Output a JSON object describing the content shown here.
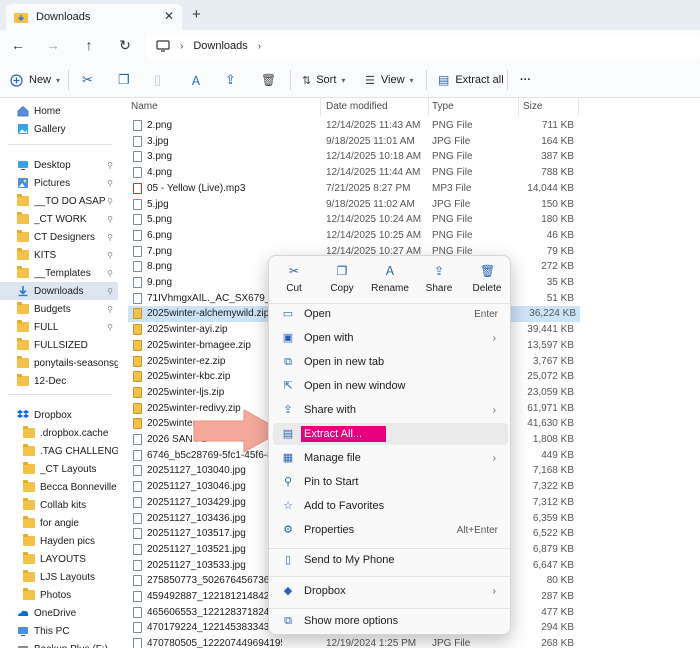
{
  "window": {
    "tab_title": "Downloads",
    "close_glyph": "✕",
    "newtab_glyph": "+"
  },
  "address": {
    "crumbs": [
      "Downloads"
    ],
    "crumb_sep": "›"
  },
  "toolbar": {
    "new_label": "New",
    "sort_label": "Sort",
    "view_label": "View",
    "extract_label": "Extract all",
    "more_glyph": "···"
  },
  "sidebar": {
    "items": [
      {
        "label": "Home",
        "icon": "home-icon"
      },
      {
        "label": "Gallery",
        "icon": "gallery-icon"
      },
      {
        "label": "Desktop",
        "icon": "desktop-icon",
        "pinned": true
      },
      {
        "label": "Pictures",
        "icon": "pictures-icon",
        "pinned": true
      },
      {
        "label": "__TO DO ASAP",
        "icon": "folder-icon",
        "pinned": true
      },
      {
        "label": "_CT WORK",
        "icon": "folder-icon",
        "pinned": true
      },
      {
        "label": "CT Designers",
        "icon": "folder-icon",
        "pinned": true
      },
      {
        "label": "KITS",
        "icon": "folder-icon",
        "pinned": true
      },
      {
        "label": "__Templates",
        "icon": "folder-icon",
        "pinned": true
      },
      {
        "label": "Downloads",
        "icon": "download-icon",
        "pinned": true
      },
      {
        "label": "Budgets",
        "icon": "folder-icon",
        "pinned": true
      },
      {
        "label": "FULL",
        "icon": "folder-icon",
        "pinned": true
      },
      {
        "label": "FULLSIZED",
        "icon": "folder-icon"
      },
      {
        "label": "ponytails-seasonsgre",
        "icon": "folder-icon"
      },
      {
        "label": "12-Dec",
        "icon": "folder-icon"
      },
      {
        "label": "Dropbox",
        "icon": "dropbox-icon"
      },
      {
        "label": ".dropbox.cache",
        "icon": "folder-icon"
      },
      {
        "label": ".TAG CHALLENGE 2",
        "icon": "folder-icon"
      },
      {
        "label": "_CT Layouts",
        "icon": "folder-icon"
      },
      {
        "label": "Becca Bonneville C1",
        "icon": "folder-icon"
      },
      {
        "label": "Collab kits",
        "icon": "folder-icon"
      },
      {
        "label": "for angie",
        "icon": "folder-icon"
      },
      {
        "label": "Hayden pics",
        "icon": "folder-icon"
      },
      {
        "label": "LAYOUTS",
        "icon": "folder-icon"
      },
      {
        "label": "LJS Layouts",
        "icon": "folder-icon"
      },
      {
        "label": "Photos",
        "icon": "folder-icon"
      },
      {
        "label": "OneDrive",
        "icon": "onedrive-icon"
      },
      {
        "label": "This PC",
        "icon": "pc-icon"
      },
      {
        "label": "Backup Plus (F:)",
        "icon": "drive-icon"
      }
    ],
    "pin_glyph": "📌"
  },
  "columns": {
    "name": "Name",
    "date": "Date modified",
    "type": "Type",
    "size": "Size"
  },
  "files": [
    {
      "name": "2.png",
      "date": "12/14/2025 11:43 AM",
      "type": "PNG File",
      "size": "711 KB",
      "kind": "img"
    },
    {
      "name": "3.jpg",
      "date": "9/18/2025 11:01 AM",
      "type": "JPG File",
      "size": "164 KB",
      "kind": "img"
    },
    {
      "name": "3.png",
      "date": "12/14/2025 10:18 AM",
      "type": "PNG File",
      "size": "387 KB",
      "kind": "img"
    },
    {
      "name": "4.png",
      "date": "12/14/2025 11:44 AM",
      "type": "PNG File",
      "size": "788 KB",
      "kind": "img"
    },
    {
      "name": "05 - Yellow (Live).mp3",
      "date": "7/21/2025 8:27 PM",
      "type": "MP3 File",
      "size": "14,044 KB",
      "kind": "mp3"
    },
    {
      "name": "5.jpg",
      "date": "9/18/2025 11:02 AM",
      "type": "JPG File",
      "size": "150 KB",
      "kind": "img"
    },
    {
      "name": "5.png",
      "date": "12/14/2025 10:24 AM",
      "type": "PNG File",
      "size": "180 KB",
      "kind": "img"
    },
    {
      "name": "6.png",
      "date": "12/14/2025 10:25 AM",
      "type": "PNG File",
      "size": "46 KB",
      "kind": "img"
    },
    {
      "name": "7.png",
      "date": "12/14/2025 10:27 AM",
      "type": "PNG File",
      "size": "79 KB",
      "kind": "img"
    },
    {
      "name": "8.png",
      "date": "",
      "type": "",
      "size": "272 KB",
      "kind": "img"
    },
    {
      "name": "9.png",
      "date": "",
      "type": "",
      "size": "35 KB",
      "kind": "img"
    },
    {
      "name": "71IVhmgxAIL._AC_SX679_.jpg",
      "date": "",
      "type": "",
      "size": "51 KB",
      "kind": "img"
    },
    {
      "name": "2025winter-alchemywild.zip",
      "date": "",
      "type": "",
      "size": "36,224 KB",
      "kind": "zip",
      "selected": true
    },
    {
      "name": "2025winter-ayi.zip",
      "date": "",
      "type": "",
      "size": "39,441 KB",
      "kind": "zip"
    },
    {
      "name": "2025winter-bmagee.zip",
      "date": "",
      "type": "",
      "size": "13,597 KB",
      "kind": "zip"
    },
    {
      "name": "2025winter-ez.zip",
      "date": "",
      "type": "",
      "size": "3,767 KB",
      "kind": "zip"
    },
    {
      "name": "2025winter-kbc.zip",
      "date": "",
      "type": "",
      "size": "25,072 KB",
      "kind": "zip"
    },
    {
      "name": "2025winter-ljs.zip",
      "date": "",
      "type": "",
      "size": "23,059 KB",
      "kind": "zip"
    },
    {
      "name": "2025winter-redivy.zip",
      "date": "",
      "type": "",
      "size": "61,971 KB",
      "kind": "zip"
    },
    {
      "name": "2025winter-s",
      "date": "",
      "type": "",
      "size": "41,630 KB",
      "kind": "zip"
    },
    {
      "name": "2026 SAN Fu",
      "date": "",
      "type": "",
      "size": "1,808 KB",
      "kind": "img"
    },
    {
      "name": "6746_b5c28769-5fc1-45f6-8a30",
      "date": "",
      "type": "",
      "size": "449 KB",
      "kind": "img"
    },
    {
      "name": "20251127_103040.jpg",
      "date": "",
      "type": "",
      "size": "7,168 KB",
      "kind": "img"
    },
    {
      "name": "20251127_103046.jpg",
      "date": "",
      "type": "",
      "size": "7,322 KB",
      "kind": "img"
    },
    {
      "name": "20251127_103429.jpg",
      "date": "",
      "type": "",
      "size": "7,312 KB",
      "kind": "img"
    },
    {
      "name": "20251127_103436.jpg",
      "date": "",
      "type": "",
      "size": "6,359 KB",
      "kind": "img"
    },
    {
      "name": "20251127_103517.jpg",
      "date": "",
      "type": "",
      "size": "6,522 KB",
      "kind": "img"
    },
    {
      "name": "20251127_103521.jpg",
      "date": "",
      "type": "",
      "size": "6,879 KB",
      "kind": "img"
    },
    {
      "name": "20251127_103533.jpg",
      "date": "",
      "type": "",
      "size": "6,647 KB",
      "kind": "img"
    },
    {
      "name": "275850773_5026764567361522_",
      "date": "",
      "type": "",
      "size": "80 KB",
      "kind": "img"
    },
    {
      "name": "459492887_1221812148421258",
      "date": "",
      "type": "",
      "size": "287 KB",
      "kind": "img"
    },
    {
      "name": "465606553_1221283718243844",
      "date": "",
      "type": "",
      "size": "477 KB",
      "kind": "img"
    },
    {
      "name": "470179224_1221453833435349",
      "date": "",
      "type": "",
      "size": "294 KB",
      "kind": "img"
    },
    {
      "name": "470780505_1222074496941957685424301...",
      "date": "12/19/2024 1:25 PM",
      "type": "JPG File",
      "size": "268 KB",
      "kind": "img"
    }
  ],
  "context_menu": {
    "quick_actions": [
      {
        "label": "Cut",
        "icon": "cut-icon",
        "glyph": "✂"
      },
      {
        "label": "Copy",
        "icon": "copy-icon",
        "glyph": "❐"
      },
      {
        "label": "Rename",
        "icon": "rename-icon",
        "glyph": "Ａ"
      },
      {
        "label": "Share",
        "icon": "share-icon",
        "glyph": "⇪"
      },
      {
        "label": "Delete",
        "icon": "delete-icon",
        "glyph": "🗑"
      }
    ],
    "items": [
      {
        "label": "Open",
        "icon": "open-icon",
        "glyph": "▭",
        "shortcut": "Enter"
      },
      {
        "label": "Open with",
        "icon": "open-with-icon",
        "glyph": "▣",
        "submenu": true
      },
      {
        "label": "Open in new tab",
        "icon": "new-tab-icon",
        "glyph": "⧉"
      },
      {
        "label": "Open in new window",
        "icon": "new-window-icon",
        "glyph": "⇱"
      },
      {
        "label": "Share with",
        "icon": "share-with-icon",
        "glyph": "⇪",
        "submenu": true
      },
      {
        "label": "Extract All...",
        "icon": "extract-icon",
        "glyph": "▤",
        "highlight": true
      },
      {
        "label": "Manage file",
        "icon": "manage-file-icon",
        "glyph": "▦",
        "submenu": true
      },
      {
        "label": "Pin to Start",
        "icon": "pin-icon",
        "glyph": "⚲"
      },
      {
        "label": "Add to Favorites",
        "icon": "star-icon",
        "glyph": "☆"
      },
      {
        "label": "Properties",
        "icon": "wrench-icon",
        "glyph": "⚙",
        "shortcut": "Alt+Enter"
      },
      {
        "label": "Send to My Phone",
        "icon": "phone-icon",
        "glyph": "▯"
      },
      {
        "label": "Dropbox",
        "icon": "dropbox-icon",
        "glyph": "◆",
        "submenu": true
      },
      {
        "label": "Show more options",
        "icon": "more-options-icon",
        "glyph": "⧉"
      }
    ],
    "submenu_glyph": "›"
  },
  "colors": {
    "accent": "#2563b6",
    "highlight": "#e6007e",
    "selection": "#cce4f7",
    "arrow": "#f4a99a"
  }
}
